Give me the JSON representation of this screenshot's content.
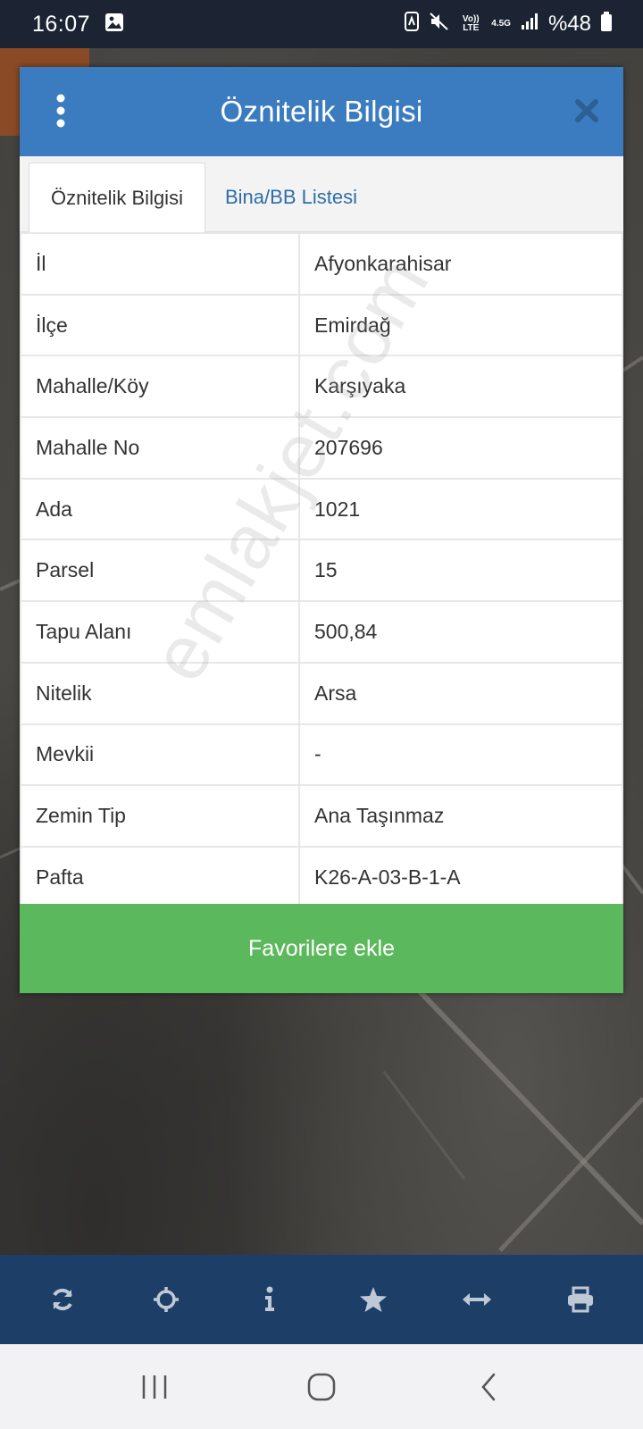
{
  "status_bar": {
    "time": "16:07",
    "network": "4.5G",
    "volte": "Vo)) LTE",
    "battery": "%48"
  },
  "dialog": {
    "title": "Öznitelik Bilgisi",
    "tabs": [
      {
        "label": "Öznitelik Bilgisi",
        "active": true
      },
      {
        "label": "Bina/BB Listesi",
        "active": false
      }
    ],
    "rows": [
      {
        "key": "İl",
        "value": "Afyonkarahisar"
      },
      {
        "key": "İlçe",
        "value": "Emirdağ"
      },
      {
        "key": "Mahalle/Köy",
        "value": "Karşıyaka"
      },
      {
        "key": "Mahalle No",
        "value": "207696"
      },
      {
        "key": "Ada",
        "value": "1021"
      },
      {
        "key": "Parsel",
        "value": "15"
      },
      {
        "key": "Tapu Alanı",
        "value": "500,84"
      },
      {
        "key": "Nitelik",
        "value": "Arsa"
      },
      {
        "key": "Mevkii",
        "value": "-"
      },
      {
        "key": "Zemin Tip",
        "value": "Ana Taşınmaz"
      },
      {
        "key": "Pafta",
        "value": "K26-A-03-B-1-A"
      }
    ],
    "favorite_button": "Favorilere ekle"
  },
  "watermark": "emlakjet.com",
  "toolbar": {
    "icons": [
      "refresh-icon",
      "locate-crosshair-icon",
      "info-icon",
      "star-icon",
      "measure-arrows-icon",
      "print-icon"
    ]
  },
  "colors": {
    "header_blue": "#3a7cbf",
    "button_green": "#5cb85c",
    "toolbar_navy": "#1d3e66",
    "status_bar": "#1c2434"
  }
}
